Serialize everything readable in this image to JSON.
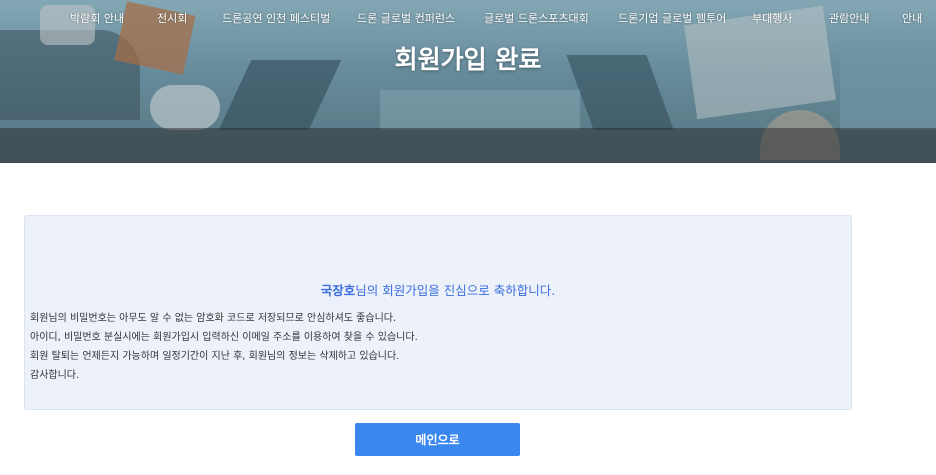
{
  "nav": {
    "items": [
      {
        "label": "박람회 안내"
      },
      {
        "label": "전시회"
      },
      {
        "label": "드론공연 인천 페스티벌"
      },
      {
        "label": "드론 글로벌 컨퍼런스"
      },
      {
        "label": "글로벌 드론스포츠대회"
      },
      {
        "label": "드론기업 글로벌 펨투어"
      },
      {
        "label": "부대행사"
      },
      {
        "label": "관람안내"
      },
      {
        "label": "안내"
      }
    ]
  },
  "banner": {
    "title": "회원가입 완료"
  },
  "message": {
    "user_name": "국장호",
    "greeting_suffix": "님의 회원가입을 진심으로 축하합니다.",
    "lines": [
      "회원님의 비밀번호는 아무도 알 수 없는 암호화 코드로 저장되므로 안심하셔도 좋습니다.",
      "아이디, 비밀번호 분실시에는 회원가입시 입력하신 이메일 주소를 이용하여 찾을 수 있습니다.",
      "회원 탈퇴는 언제든지 가능하며 일정기간이 지난 후, 회원님의 정보는 삭제하고 있습니다.",
      "감사합니다."
    ]
  },
  "actions": {
    "main_label": "메인으로"
  },
  "colors": {
    "accent": "#3a87f0",
    "greeting_text": "#3d6ee0",
    "box_bg": "#ecf1fa"
  }
}
